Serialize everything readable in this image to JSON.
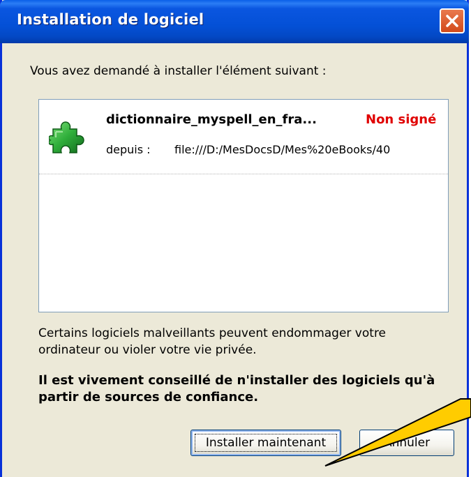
{
  "window": {
    "title": "Installation de logiciel"
  },
  "intro_text": "Vous avez demandé à installer l'élément suivant :",
  "item": {
    "name": "dictionnaire_myspell_en_fra...",
    "status": "Non signé",
    "from_label": "depuis :",
    "from_url": "file:///D:/MesDocsD/Mes%20eBooks/40"
  },
  "warning_text": "Certains logiciels malveillants peuvent endommager votre ordinateur ou violer votre vie privée.",
  "advice_text": "Il est vivement conseillé de n'installer des logiciels qu'à partir de sources de confiance.",
  "buttons": {
    "install_label": "Installer maintenant",
    "cancel_label": "Annuler"
  },
  "icons": {
    "close": "close-icon",
    "puzzle": "puzzle-piece-icon"
  },
  "colors": {
    "titlebar": "#0450d6",
    "status_unsigned": "#e00000",
    "callout": "#ffcc00"
  }
}
